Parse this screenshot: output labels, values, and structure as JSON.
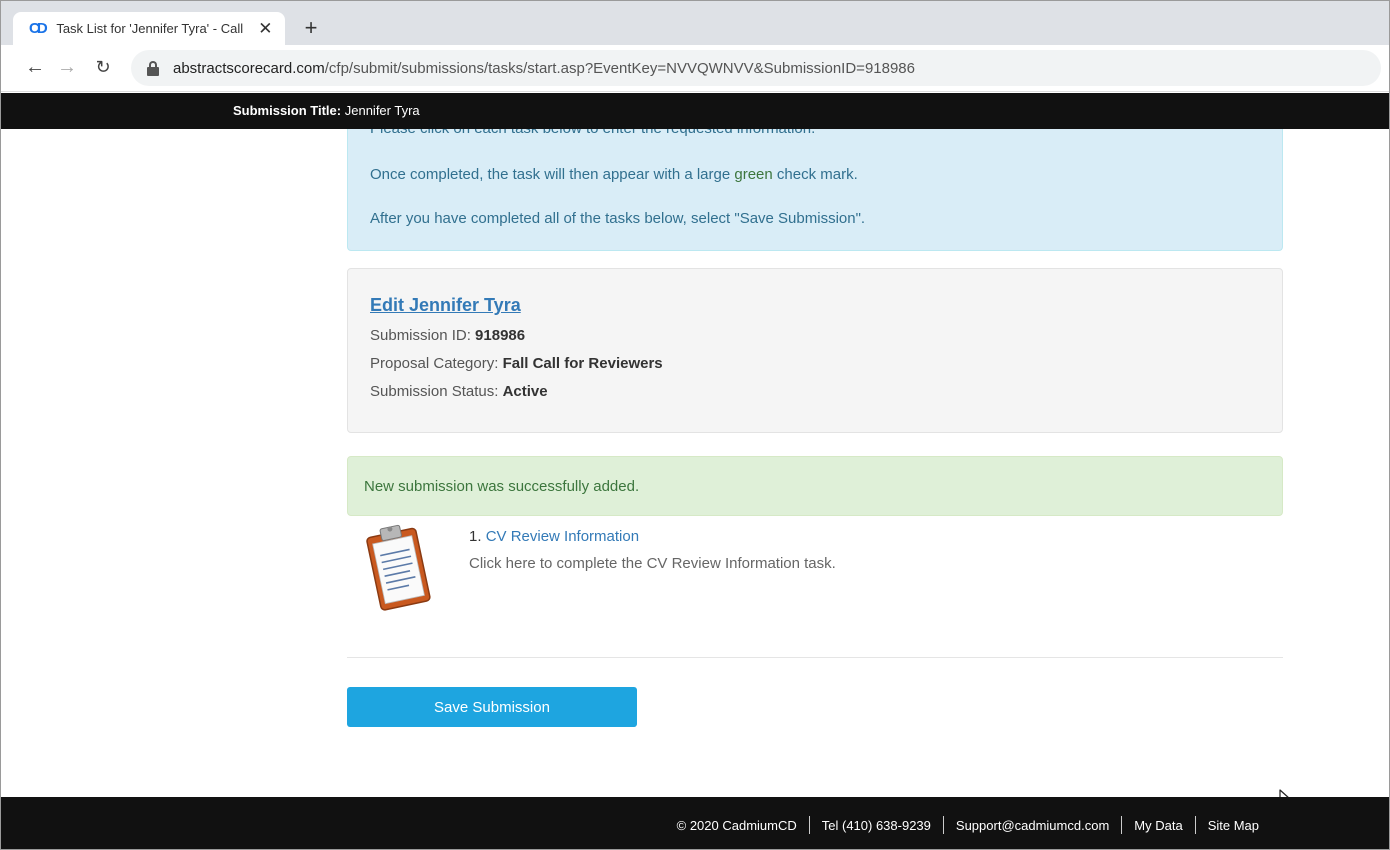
{
  "browser": {
    "tab_title": "Task List for 'Jennifer Tyra' - Call f",
    "favicon_text": "CD",
    "url_host": "abstractscorecard.com",
    "url_path": "/cfp/submit/submissions/tasks/start.asp?EventKey=NVVQWNVV&SubmissionID=918986"
  },
  "titlebar": {
    "label": "Submission Title:",
    "value": "Jennifer Tyra"
  },
  "info": {
    "line1": "Please click on each task below to enter the requested information.",
    "line2_before": "Once completed, the task will then appear with a large ",
    "line2_green": "green",
    "line2_after": " check mark.",
    "line3": "After you have completed all of the tasks below, select \"Save Submission\"."
  },
  "submission": {
    "edit_link": "Edit Jennifer Tyra",
    "id_label": "Submission ID: ",
    "id_value": "918986",
    "category_label": "Proposal Category: ",
    "category_value": "Fall Call for Reviewers",
    "status_label": "Submission Status: ",
    "status_value": "Active"
  },
  "alert": {
    "message": "New submission was successfully added."
  },
  "task": {
    "number": "1. ",
    "title": "CV Review Information",
    "description": "Click here to complete the CV Review Information task."
  },
  "actions": {
    "save_label": "Save Submission"
  },
  "footer": {
    "copyright": "© 2020 CadmiumCD",
    "tel": "Tel (410) 638-9239",
    "email": "Support@cadmiumcd.com",
    "my_data": "My Data",
    "site_map": "Site Map"
  },
  "colors": {
    "link": "#337ab7",
    "info_bg": "#d9edf7",
    "success_bg": "#dff0d8",
    "button": "#1ea5e0",
    "bar": "#111111"
  }
}
